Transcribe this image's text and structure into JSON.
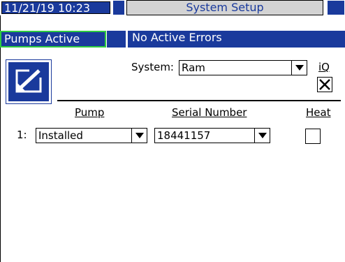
{
  "header": {
    "datetime": "11/21/19 10:23",
    "title": "System Setup",
    "pumps_status": "Pumps Active",
    "errors_status": "No Active Errors"
  },
  "system": {
    "label": "System:",
    "value": "Ram",
    "iq_label": "iQ",
    "iq_checked": true
  },
  "table": {
    "columns": [
      "Pump",
      "Serial Number",
      "Heat"
    ],
    "rows": [
      {
        "index": "1:",
        "pump": "Installed",
        "serial": "18441157",
        "heat": false
      }
    ]
  },
  "colors": {
    "accent_blue": "#1a3a9c",
    "active_green": "#2ecc40",
    "grey": "#d3d3d3"
  },
  "icons": [
    "edit-icon",
    "dropdown-arrow-icon",
    "checkbox-checked-icon"
  ]
}
